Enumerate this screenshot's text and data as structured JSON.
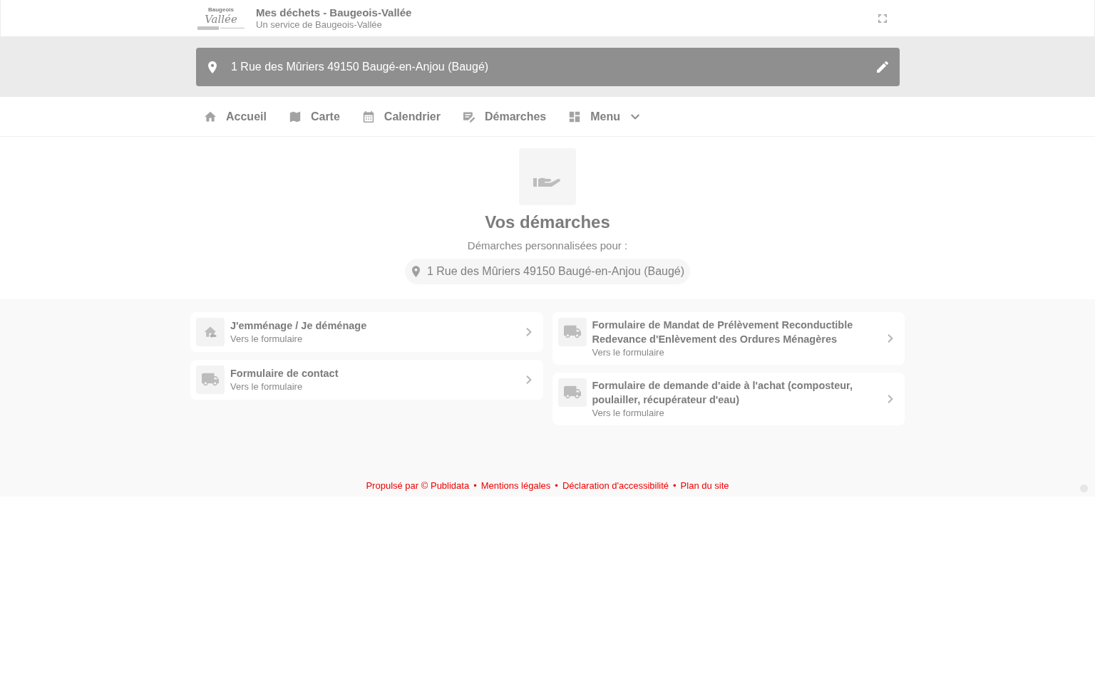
{
  "header": {
    "logo": {
      "top": "Baugeois",
      "wordmark": "Vallée"
    },
    "title": "Mes déchets - Baugeois-Vallée",
    "subtitle": "Un service de Baugeois-Vallée"
  },
  "address_bar": {
    "address": "1 Rue des Mûriers 49150 Baugé-en-Anjou (Baugé)"
  },
  "nav": [
    {
      "label": "Accueil",
      "kind": "link"
    },
    {
      "label": "Carte",
      "kind": "link"
    },
    {
      "label": "Calendrier",
      "kind": "link"
    },
    {
      "label": "Démarches",
      "kind": "link"
    },
    {
      "label": "Menu",
      "kind": "dropdown"
    }
  ],
  "hero": {
    "title": "Vos démarches",
    "subtitle": "Démarches personnalisées pour :",
    "address": "1 Rue des Mûriers 49150 Baugé-en-Anjou (Baugé)"
  },
  "procedure_columns": [
    [
      {
        "kind": "moving",
        "title": "J'emménage / Je déménage",
        "subtitle": "Vers le formulaire"
      },
      {
        "kind": "form",
        "title": "Formulaire de contact",
        "subtitle": "Vers le formulaire"
      }
    ],
    [
      {
        "kind": "form",
        "title": "Formulaire de Mandat de Prélèvement Reconductible Redevance d'Enlèvement des Ordures Ménagères",
        "subtitle": "Vers le formulaire"
      },
      {
        "kind": "form",
        "title": "Formulaire de demande d'aide à l'achat (composteur, poulailler, récupérateur d'eau)",
        "subtitle": "Vers le formulaire"
      }
    ]
  ],
  "footer": {
    "separator": "•",
    "links": [
      "Propulsé par © Publidata",
      "Mentions légales",
      "Déclaration d'accessibilité",
      "Plan du site"
    ]
  }
}
